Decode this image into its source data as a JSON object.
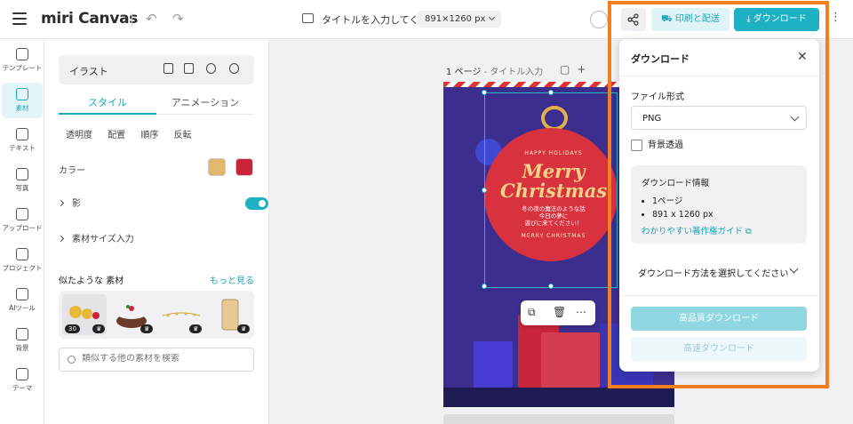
{
  "app": {
    "logo": "miri Canvas"
  },
  "header": {
    "doc_title": "タイトルを入力してく...",
    "size_label": "891×1260 px",
    "print_label": "印刷と配送",
    "download_label": "ダウンロード"
  },
  "rail": {
    "items": [
      {
        "label": "テンプレート"
      },
      {
        "label": "素材"
      },
      {
        "label": "テキスト"
      },
      {
        "label": "写真"
      },
      {
        "label": "アップロード"
      },
      {
        "label": "プロジェクト"
      },
      {
        "label": "AIツール"
      },
      {
        "label": "背景"
      },
      {
        "label": "テーマ"
      }
    ]
  },
  "panel": {
    "title": "イラスト",
    "tabs": [
      "スタイル",
      "アニメーション"
    ],
    "subopts": [
      "透明度",
      "配置",
      "順序",
      "反転"
    ],
    "color_label": "カラー",
    "colors": [
      "#e2b96a",
      "#c8243a"
    ],
    "shadow_label": "影",
    "size_label": "素材サイズ入力",
    "similar_title": "似たような 素材",
    "similar_more": "もっと見る",
    "thumb_badge": "30",
    "search_placeholder": "類似する他の素材を検索"
  },
  "canvas": {
    "page_label": "1 ページ",
    "page_sub": " - タイトル入力",
    "art_top": "HAPPY HOLIDAYS",
    "art_merry": "Merry",
    "art_christmas": "Christmas",
    "art_jp_1": "冬の夜の魔法のような話",
    "art_jp_2": "今日の夢に",
    "art_jp_3": "遊びに来てください！",
    "art_bottom": "MERRY CHRISTMAS"
  },
  "download_panel": {
    "title": "ダウンロード",
    "format_label": "ファイル形式",
    "format_value": "PNG",
    "transparent_label": "背景透過",
    "info_title": "ダウンロード情報",
    "info_pages": "1ページ",
    "info_size": "891 x 1260 px",
    "info_link": "わかりやすい著作権ガイド",
    "method_label": "ダウンロード方法を選択してください",
    "hq_button": "高品質ダウンロード",
    "fast_button": "高速ダウンロード"
  }
}
